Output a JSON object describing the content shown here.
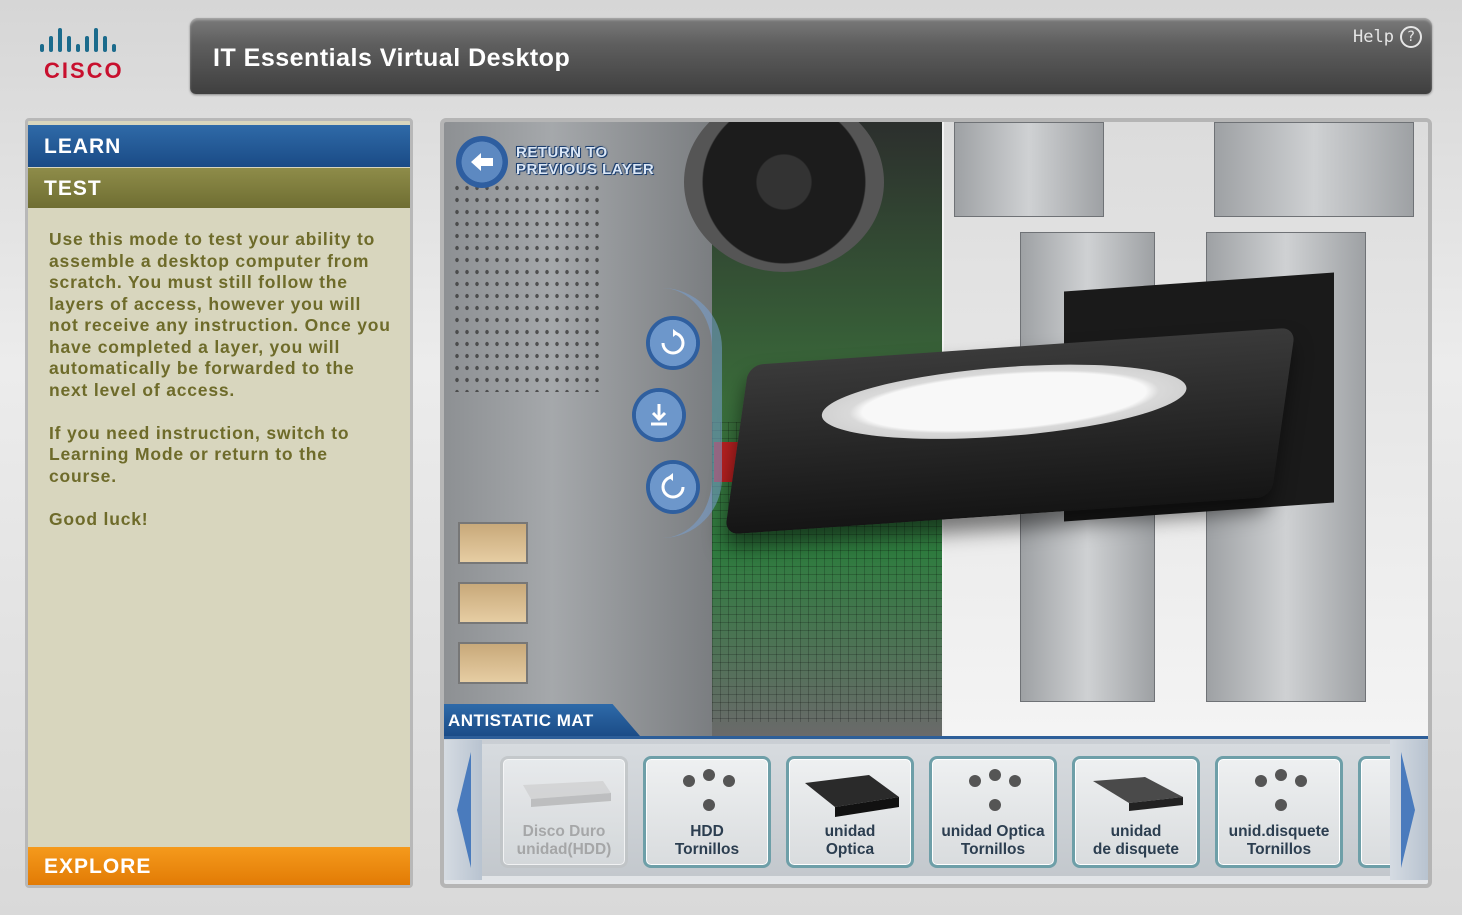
{
  "header": {
    "logo_text": "CISCO",
    "title": "IT Essentials Virtual Desktop",
    "help_label": "Help",
    "help_icon": "?"
  },
  "left_panel": {
    "learn_tab": "LEARN",
    "test_tab": "TEST",
    "description": [
      "Use this mode to test your ability to assemble a desktop computer from scratch. You must still follow the layers of access, however you will not receive any instruction. Once you have completed a layer, you will automatically be forwarded to the next level of access.",
      "If you need instruction, switch to Learning Mode or return to the course.",
      "Good luck!"
    ],
    "explore_tab": "EXPLORE"
  },
  "viewport": {
    "return_label_line1": "RETURN TO",
    "return_label_line2": "PREVIOUS LAYER",
    "mat_label": "ANTISTATIC MAT"
  },
  "tray": {
    "items": [
      {
        "line1": "Disco Duro",
        "line2": "unidad(HDD)",
        "state": "disabled"
      },
      {
        "line1": "HDD",
        "line2": "Tornillos",
        "state": "enabled"
      },
      {
        "line1": "unidad",
        "line2": "Optica",
        "state": "enabled"
      },
      {
        "line1": "unidad Optica",
        "line2": "Tornillos",
        "state": "enabled"
      },
      {
        "line1": "unidad",
        "line2": "de disquete",
        "state": "enabled"
      },
      {
        "line1": "unid.disquete",
        "line2": "Tornillos",
        "state": "enabled"
      }
    ]
  },
  "colors": {
    "learn_blue": "#1a4b86",
    "test_olive": "#7a783c",
    "explore_orange": "#e27b05",
    "text_olive": "#6e6b2a",
    "cisco_red": "#c8102e"
  }
}
